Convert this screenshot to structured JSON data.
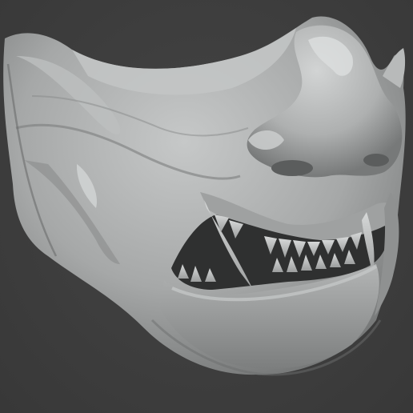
{
  "scene": {
    "subject": "oni-half-mask-sculpt",
    "background_color": "#3d3d3d",
    "clay_base_color": "#a9abab",
    "clay_highlight_color": "#d0d2d2",
    "clay_shadow_color": "#5a5c5c",
    "mouth_interior_color": "#2f3030",
    "tooth_color": "#c8caca"
  }
}
